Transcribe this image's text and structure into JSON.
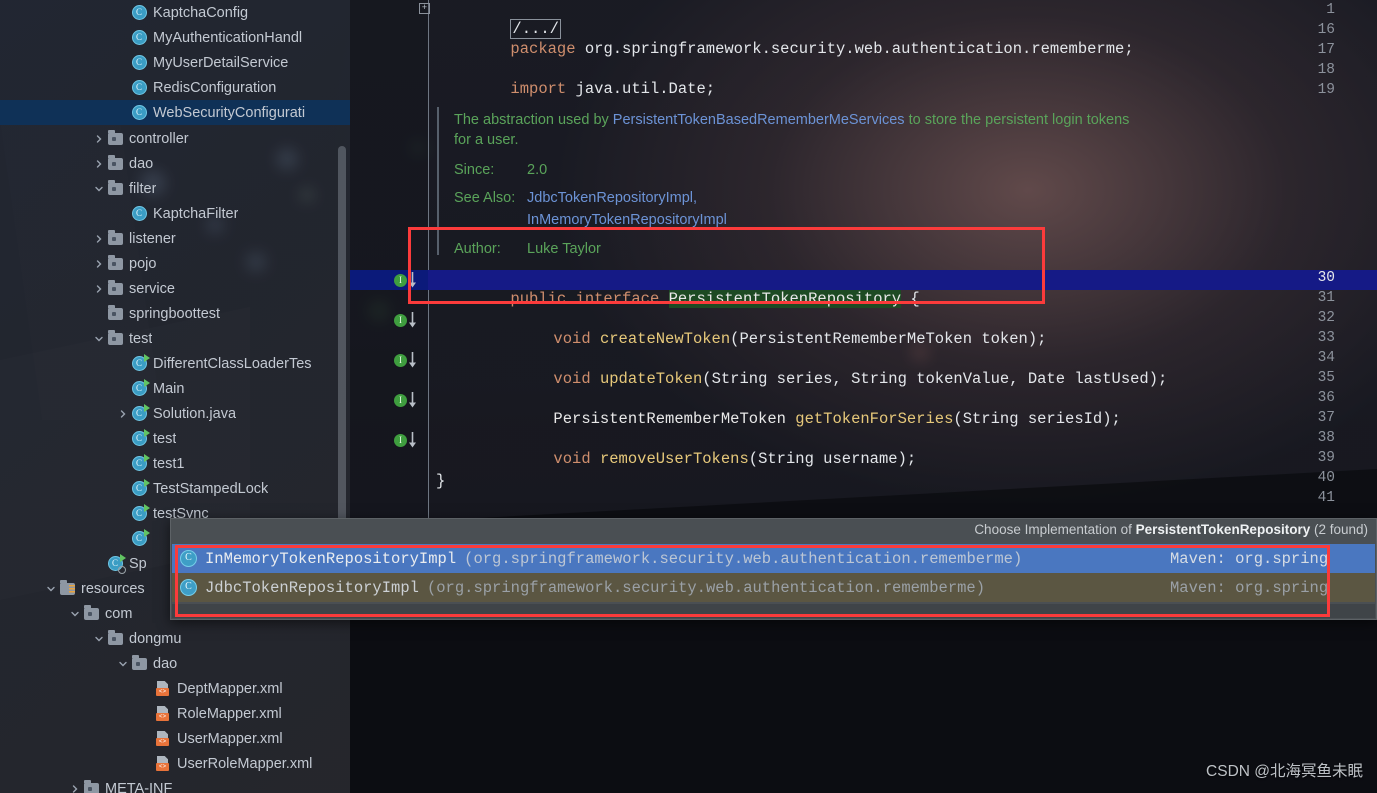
{
  "sidebar": {
    "scrollbar": "vertical-scrollbar",
    "items": [
      {
        "label": "KaptchaConfig",
        "indent": 4,
        "icon": "class-icon",
        "twisty": "none",
        "selected": false
      },
      {
        "label": "MyAuthenticationHandl",
        "indent": 4,
        "icon": "class-icon",
        "twisty": "none",
        "selected": false
      },
      {
        "label": "MyUserDetailService",
        "indent": 4,
        "icon": "class-icon",
        "twisty": "none",
        "selected": false
      },
      {
        "label": "RedisConfiguration",
        "indent": 4,
        "icon": "class-icon",
        "twisty": "none",
        "selected": false
      },
      {
        "label": "WebSecurityConfigurati",
        "indent": 4,
        "icon": "class-icon",
        "twisty": "none",
        "selected": true
      },
      {
        "label": "controller",
        "indent": 3,
        "icon": "folder-icon",
        "twisty": "collapsed",
        "selected": false
      },
      {
        "label": "dao",
        "indent": 3,
        "icon": "folder-icon",
        "twisty": "collapsed",
        "selected": false
      },
      {
        "label": "filter",
        "indent": 3,
        "icon": "folder-icon",
        "twisty": "expanded",
        "selected": false
      },
      {
        "label": "KaptchaFilter",
        "indent": 4,
        "icon": "class-icon",
        "twisty": "none",
        "selected": false
      },
      {
        "label": "listener",
        "indent": 3,
        "icon": "folder-icon",
        "twisty": "collapsed",
        "selected": false
      },
      {
        "label": "pojo",
        "indent": 3,
        "icon": "folder-icon",
        "twisty": "collapsed",
        "selected": false
      },
      {
        "label": "service",
        "indent": 3,
        "icon": "folder-icon",
        "twisty": "collapsed",
        "selected": false
      },
      {
        "label": "springboottest",
        "indent": 3,
        "icon": "folder-icon",
        "twisty": "none",
        "selected": false
      },
      {
        "label": "test",
        "indent": 3,
        "icon": "folder-icon",
        "twisty": "expanded",
        "selected": false
      },
      {
        "label": "DifferentClassLoaderTes",
        "indent": 4,
        "icon": "runnable-class-icon",
        "twisty": "none",
        "selected": false
      },
      {
        "label": "Main",
        "indent": 4,
        "icon": "runnable-class-icon",
        "twisty": "none",
        "selected": false
      },
      {
        "label": "Solution.java",
        "indent": 4,
        "icon": "runnable-class-icon",
        "twisty": "collapsed",
        "selected": false
      },
      {
        "label": "test",
        "indent": 4,
        "icon": "runnable-class-icon",
        "twisty": "none",
        "selected": false
      },
      {
        "label": "test1",
        "indent": 4,
        "icon": "runnable-class-icon",
        "twisty": "none",
        "selected": false
      },
      {
        "label": "TestStampedLock",
        "indent": 4,
        "icon": "runnable-class-icon",
        "twisty": "none",
        "selected": false
      },
      {
        "label": "testSync",
        "indent": 4,
        "icon": "runnable-class-icon",
        "twisty": "none",
        "selected": false
      },
      {
        "label": "",
        "indent": 4,
        "icon": "runnable-class-icon",
        "twisty": "none",
        "selected": false
      },
      {
        "label": "Sp",
        "indent": 3,
        "icon": "spring-app-icon",
        "twisty": "none",
        "selected": false
      },
      {
        "label": "resources",
        "indent": 1,
        "icon": "resources-folder-icon",
        "twisty": "expanded",
        "selected": false
      },
      {
        "label": "com",
        "indent": 2,
        "icon": "folder-icon",
        "twisty": "expanded",
        "selected": false
      },
      {
        "label": "dongmu",
        "indent": 3,
        "icon": "folder-icon",
        "twisty": "expanded",
        "selected": false
      },
      {
        "label": "dao",
        "indent": 4,
        "icon": "folder-icon",
        "twisty": "expanded",
        "selected": false
      },
      {
        "label": "DeptMapper.xml",
        "indent": 5,
        "icon": "xml-file-icon",
        "twisty": "none",
        "selected": false
      },
      {
        "label": "RoleMapper.xml",
        "indent": 5,
        "icon": "xml-file-icon",
        "twisty": "none",
        "selected": false
      },
      {
        "label": "UserMapper.xml",
        "indent": 5,
        "icon": "xml-file-icon",
        "twisty": "none",
        "selected": false
      },
      {
        "label": "UserRoleMapper.xml",
        "indent": 5,
        "icon": "xml-file-icon",
        "twisty": "none",
        "selected": false
      },
      {
        "label": "META-INF",
        "indent": 2,
        "icon": "folder-icon",
        "twisty": "collapsed",
        "selected": false
      }
    ]
  },
  "editor": {
    "fold_marker": "/.../",
    "gutter_lines": [
      "1",
      "16",
      "17",
      "18",
      "19",
      "30",
      "31",
      "32",
      "33",
      "34",
      "35",
      "36",
      "37",
      "38",
      "39",
      "40",
      "41"
    ],
    "current_line": "30",
    "impl_marker_letter": "I",
    "code": {
      "package_kw": "package",
      "package_name": " org.springframework.security.web.authentication.rememberme;",
      "import_kw": "import",
      "import_name": " java.util.Date;",
      "line30_kw": "public interface ",
      "line30_type": "PersistentTokenRepository",
      "line30_brace": " {",
      "m1_ret": "void ",
      "m1_name": "createNewToken",
      "m1_args": "(PersistentRememberMeToken token);",
      "m2_ret": "void ",
      "m2_name": "updateToken",
      "m2_args": "(String series, String tokenValue, Date lastUsed);",
      "m3_ret": "PersistentRememberMeToken ",
      "m3_name": "getTokenForSeries",
      "m3_args": "(String seriesId);",
      "m4_ret": "void ",
      "m4_name": "removeUserTokens",
      "m4_args": "(String username);",
      "close_brace": "}"
    },
    "javadoc": {
      "line1_a": "The abstraction used by ",
      "line1_ref": "PersistentTokenBasedRememberMeServices",
      "line1_b": " to store the persistent login tokens",
      "line2": "for a user.",
      "since_label": "Since:",
      "since_value": "2.0",
      "seealso_label": "See Also:",
      "seealso_1": "JdbcTokenRepositoryImpl,",
      "seealso_2": "InMemoryTokenRepositoryImpl",
      "author_label": "Author:",
      "author_value": "Luke Taylor"
    }
  },
  "popup": {
    "title_prefix": "Choose Implementation of ",
    "title_type": "PersistentTokenRepository",
    "title_suffix": " (2 found)",
    "rows": [
      {
        "icon": "class-icon",
        "name": "InMemoryTokenRepositoryImpl",
        "package": "(org.springframework.security.web.authentication.rememberme)",
        "maven": "Maven: org.spring",
        "selected": true
      },
      {
        "icon": "class-icon",
        "name": "JdbcTokenRepositoryImpl",
        "package": "(org.springframework.security.web.authentication.rememberme)",
        "maven": "Maven: org.spring",
        "selected": false
      }
    ]
  },
  "annotations": {
    "box_color": "#fb3b3b",
    "box_code_label": "highlight-interface-declaration",
    "box_popup_label": "highlight-implementation-list"
  },
  "watermark": {
    "text": "CSDN @北海冥鱼未眠"
  }
}
